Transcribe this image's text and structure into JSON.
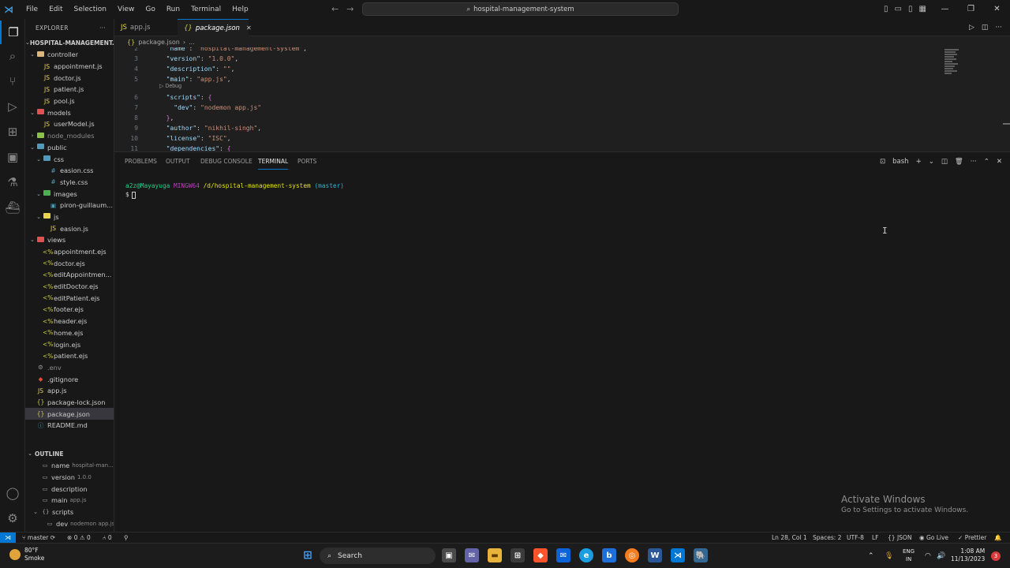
{
  "titlebar": {
    "menu": [
      "File",
      "Edit",
      "Selection",
      "View",
      "Go",
      "Run",
      "Terminal",
      "Help"
    ],
    "command_center": "hospital-management-system"
  },
  "sidebar": {
    "title": "EXPLORER",
    "workspace": "HOSPITAL-MANAGEMENT...",
    "tree": [
      {
        "depth": 1,
        "type": "folder",
        "open": true,
        "name": "controller",
        "color": "#dcb67a"
      },
      {
        "depth": 2,
        "type": "js",
        "name": "appointment.js"
      },
      {
        "depth": 2,
        "type": "js",
        "name": "doctor.js"
      },
      {
        "depth": 2,
        "type": "js",
        "name": "patient.js"
      },
      {
        "depth": 2,
        "type": "js",
        "name": "pool.js"
      },
      {
        "depth": 1,
        "type": "folder",
        "open": true,
        "name": "models",
        "color": "#e05252"
      },
      {
        "depth": 2,
        "type": "js",
        "name": "userModel.js"
      },
      {
        "depth": 1,
        "type": "folder",
        "open": false,
        "name": "node_modules",
        "color": "#8bc34a",
        "dim": true
      },
      {
        "depth": 1,
        "type": "folder",
        "open": true,
        "name": "public",
        "color": "#519aba"
      },
      {
        "depth": 2,
        "type": "folder",
        "open": true,
        "name": "css",
        "color": "#519aba"
      },
      {
        "depth": 3,
        "type": "css",
        "name": "easion.css"
      },
      {
        "depth": 3,
        "type": "css",
        "name": "style.css"
      },
      {
        "depth": 2,
        "type": "folder",
        "open": true,
        "name": "images",
        "color": "#4caf50"
      },
      {
        "depth": 3,
        "type": "img",
        "name": "piron-guillaum..."
      },
      {
        "depth": 2,
        "type": "folder",
        "open": true,
        "name": "js",
        "color": "#e8d44d"
      },
      {
        "depth": 3,
        "type": "js",
        "name": "easion.js"
      },
      {
        "depth": 1,
        "type": "folder",
        "open": true,
        "name": "views",
        "color": "#e05252"
      },
      {
        "depth": 2,
        "type": "ejs",
        "name": "appointment.ejs"
      },
      {
        "depth": 2,
        "type": "ejs",
        "name": "doctor.ejs"
      },
      {
        "depth": 2,
        "type": "ejs",
        "name": "editAppointmen..."
      },
      {
        "depth": 2,
        "type": "ejs",
        "name": "editDoctor.ejs"
      },
      {
        "depth": 2,
        "type": "ejs",
        "name": "editPatient.ejs"
      },
      {
        "depth": 2,
        "type": "ejs",
        "name": "footer.ejs"
      },
      {
        "depth": 2,
        "type": "ejs",
        "name": "header.ejs"
      },
      {
        "depth": 2,
        "type": "ejs",
        "name": "home.ejs"
      },
      {
        "depth": 2,
        "type": "ejs",
        "name": "login.ejs"
      },
      {
        "depth": 2,
        "type": "ejs",
        "name": "patient.ejs"
      },
      {
        "depth": 1,
        "type": "env",
        "name": ".env",
        "dim": true
      },
      {
        "depth": 1,
        "type": "git",
        "name": ".gitignore"
      },
      {
        "depth": 1,
        "type": "js",
        "name": "app.js"
      },
      {
        "depth": 1,
        "type": "json",
        "name": "package-lock.json"
      },
      {
        "depth": 1,
        "type": "json",
        "name": "package.json",
        "selected": true
      },
      {
        "depth": 1,
        "type": "md",
        "name": "README.md"
      }
    ],
    "outline_title": "OUTLINE",
    "outline": [
      {
        "depth": 1,
        "key": "name",
        "value": "hospital-man..."
      },
      {
        "depth": 1,
        "key": "version",
        "value": "1.0.0"
      },
      {
        "depth": 1,
        "key": "description",
        "value": ""
      },
      {
        "depth": 1,
        "key": "main",
        "value": "app.js"
      },
      {
        "depth": 0,
        "key": "scripts",
        "value": "",
        "chevron": true
      },
      {
        "depth": 2,
        "key": "dev",
        "value": "nodemon app.js"
      }
    ]
  },
  "tabs": [
    {
      "label": "app.js",
      "type": "js",
      "active": false
    },
    {
      "label": "package.json",
      "type": "json",
      "active": true
    }
  ],
  "breadcrumb": {
    "file": "package.json",
    "rest": "..."
  },
  "editor": {
    "codelens": "Debug",
    "lines": [
      {
        "n": "2",
        "text": "  \"name\": \"hospital-management-system\","
      },
      {
        "n": "3",
        "text": "  \"version\": \"1.0.0\","
      },
      {
        "n": "4",
        "text": "  \"description\": \"\","
      },
      {
        "n": "5",
        "text": "  \"main\": \"app.js\","
      },
      {
        "n": "6",
        "text": "  \"scripts\": {"
      },
      {
        "n": "7",
        "text": "    \"dev\": \"nodemon app.js\""
      },
      {
        "n": "8",
        "text": "  },"
      },
      {
        "n": "9",
        "text": "  \"author\": \"nikhil-singh\","
      },
      {
        "n": "10",
        "text": "  \"license\": \"ISC\","
      },
      {
        "n": "11",
        "text": "  \"dependencies\": {"
      }
    ]
  },
  "panel": {
    "tabs": [
      "PROBLEMS",
      "OUTPUT",
      "DEBUG CONSOLE",
      "TERMINAL",
      "PORTS"
    ],
    "active_tab": "TERMINAL",
    "shell": "bash",
    "prompt": {
      "user": "a2z@Mayayuga",
      "system": "MINGW64",
      "path": "/d/hospital-management-system",
      "branch": "(master)",
      "symbol": "$"
    }
  },
  "activation": {
    "line1": "Activate Windows",
    "line2": "Go to Settings to activate Windows."
  },
  "statusbar": {
    "branch": "master",
    "errors": "0",
    "warnings": "0",
    "ports": "0",
    "cursor": "Ln 28, Col 1",
    "spaces": "Spaces: 2",
    "encoding": "UTF-8",
    "eol": "LF",
    "language": "JSON",
    "golive": "Go Live",
    "prettier": "Prettier"
  },
  "taskbar": {
    "temperature": "80°F",
    "weather": "Smoke",
    "search": "Search",
    "lang1": "ENG",
    "lang2": "IN",
    "time": "1:08 AM",
    "date": "11/13/2023",
    "notifications": "3"
  }
}
